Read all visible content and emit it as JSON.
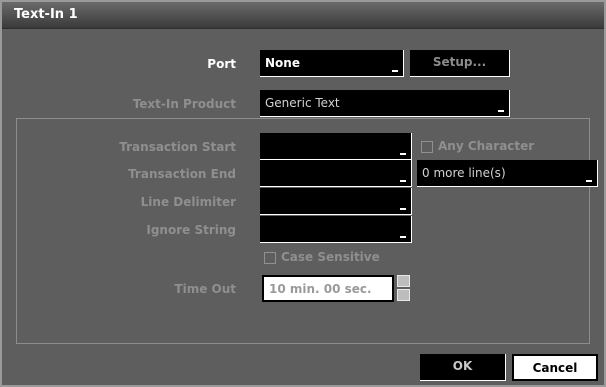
{
  "dialog": {
    "title": "Text-In 1"
  },
  "port": {
    "label": "Port",
    "value": "None",
    "setup_label": "Setup..."
  },
  "product": {
    "label": "Text-In Product",
    "value": "Generic Text"
  },
  "transaction_start": {
    "label": "Transaction Start",
    "value": ""
  },
  "any_character": {
    "label": "Any Character",
    "checked": false
  },
  "transaction_end": {
    "label": "Transaction End",
    "value": "",
    "more_lines": "0 more line(s)"
  },
  "line_delimiter": {
    "label": "Line Delimiter",
    "value": ""
  },
  "ignore_string": {
    "label": "Ignore String",
    "value": ""
  },
  "case_sensitive": {
    "label": "Case Sensitive",
    "checked": false
  },
  "timeout": {
    "label": "Time Out",
    "value": "10 min. 00 sec."
  },
  "buttons": {
    "ok": "OK",
    "cancel": "Cancel"
  },
  "colors": {
    "panel": "#5e5e5e",
    "field": "#000000",
    "label_active": "#ffffff",
    "label_disabled": "#8f8f8f"
  }
}
